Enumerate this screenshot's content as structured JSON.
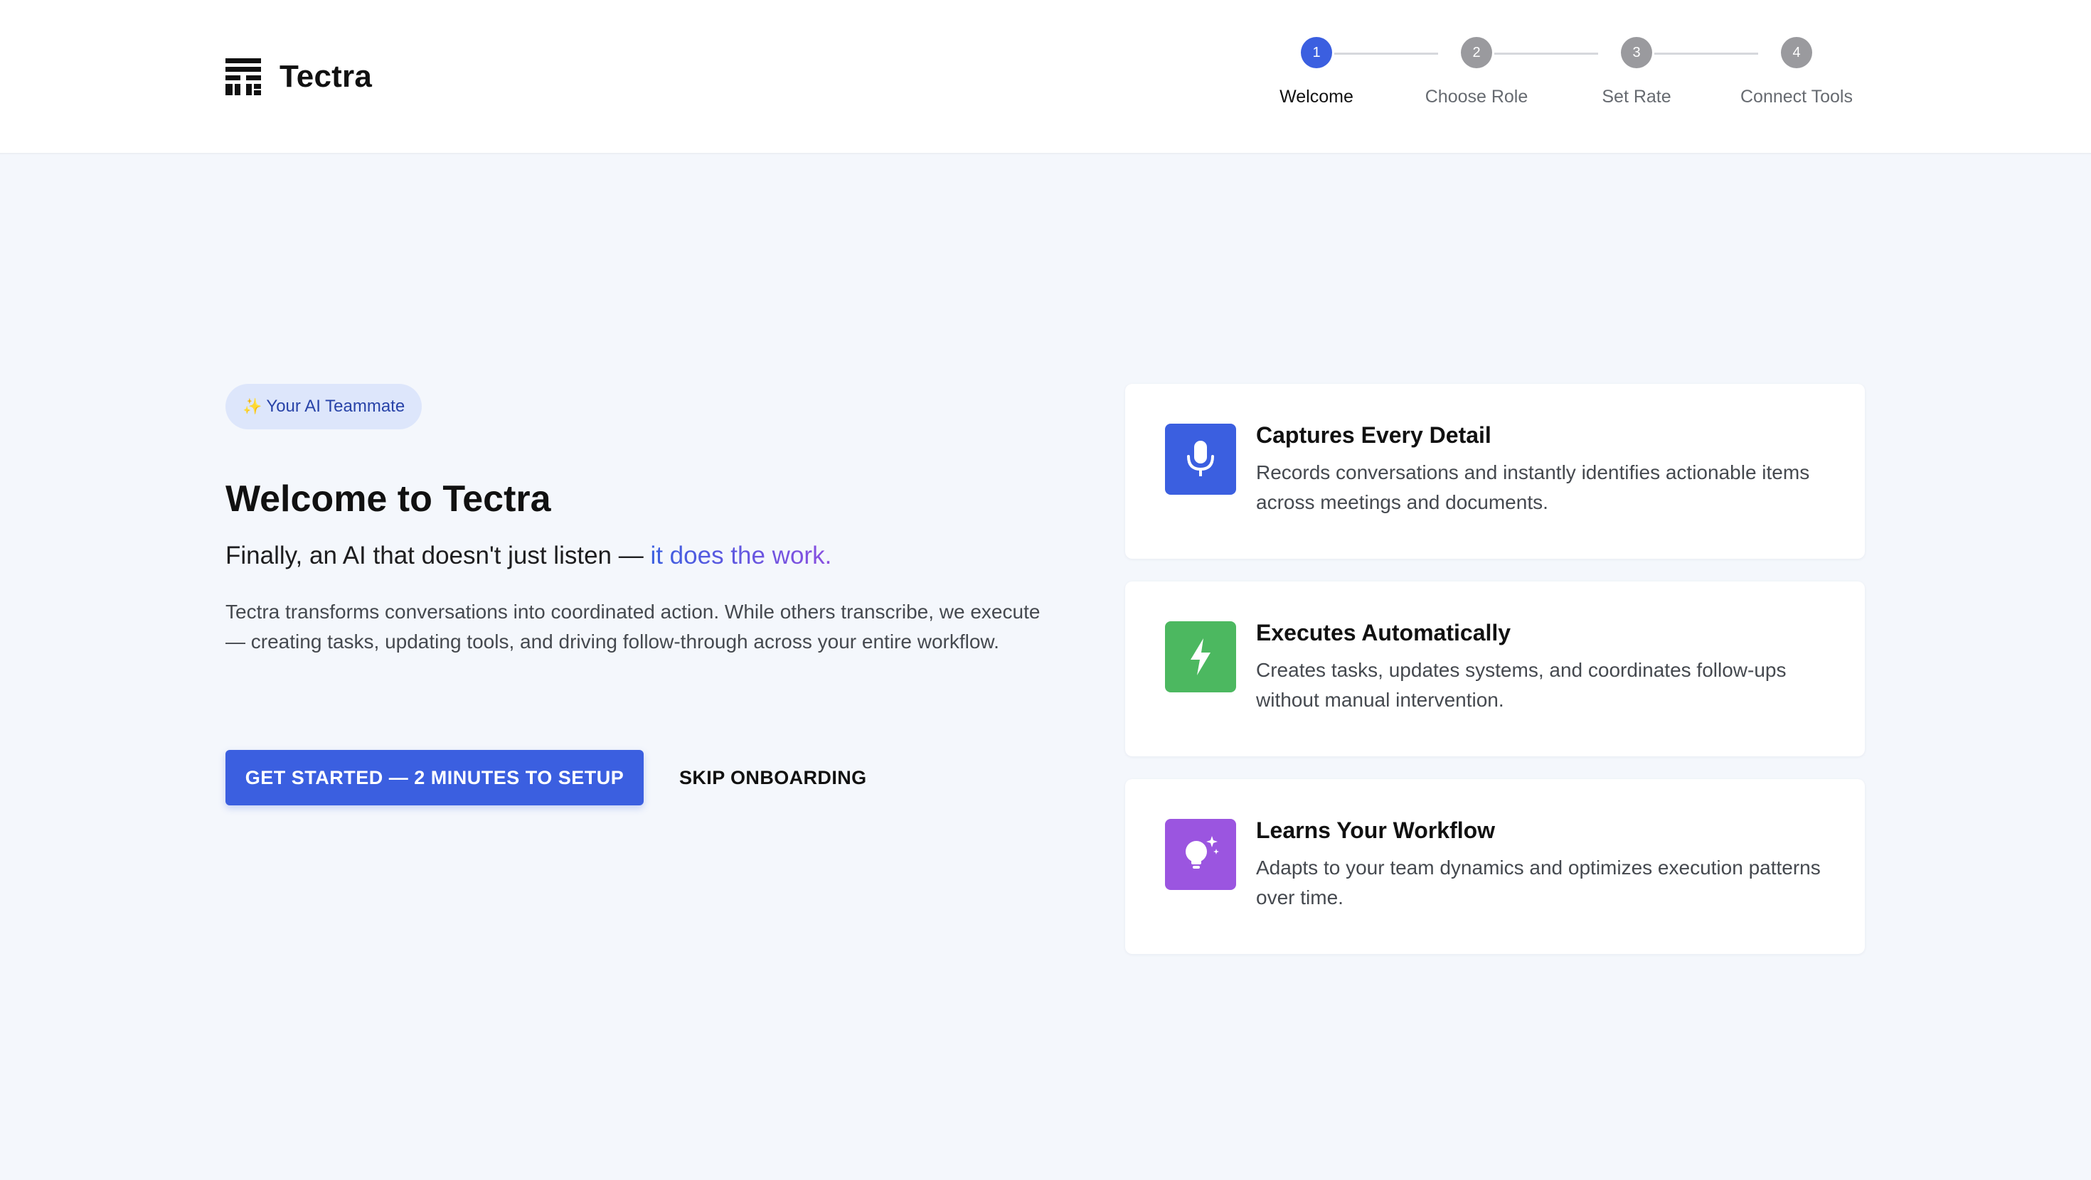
{
  "app": {
    "name": "Tectra",
    "logo_icon": "tectra-logo-icon"
  },
  "stepper": {
    "steps": [
      {
        "number": "1",
        "label": "Welcome",
        "active": true
      },
      {
        "number": "2",
        "label": "Choose Role",
        "active": false
      },
      {
        "number": "3",
        "label": "Set Rate",
        "active": false
      },
      {
        "number": "4",
        "label": "Connect Tools",
        "active": false
      }
    ],
    "active_color": "#3b5fe0",
    "inactive_color": "#9a9a9e"
  },
  "hero": {
    "badge_icon": "sparkles-icon",
    "badge_icon_glyph": "✨",
    "badge": "Your AI Teammate",
    "title": "Welcome to Tectra",
    "subtitle_prefix": "Finally, an AI that doesn't just listen — ",
    "subtitle_accent": "it does the work.",
    "description": "Tectra transforms conversations into coordinated action. While others transcribe, we execute — creating tasks, updating tools, and driving follow-through across your entire workflow.",
    "primary_cta": "GET STARTED — 2 MINUTES TO SETUP",
    "secondary_cta": "SKIP ONBOARDING"
  },
  "features": [
    {
      "icon": "microphone-icon",
      "color": "#3b5fe0",
      "title": "Captures Every Detail",
      "description": "Records conversations and instantly identifies actionable items across meetings and documents."
    },
    {
      "icon": "lightning-bolt-icon",
      "color": "#4cb860",
      "title": "Executes Automatically",
      "description": "Creates tasks, updates systems, and coordinates follow-ups without manual intervention."
    },
    {
      "icon": "lightbulb-icon",
      "color": "#9b55e0",
      "title": "Learns Your Workflow",
      "description": "Adapts to your team dynamics and optimizes execution patterns over time."
    }
  ],
  "colors": {
    "accent": "#3b5fe0",
    "page_background": "#f4f7fc",
    "badge_background": "#dde6fb"
  }
}
